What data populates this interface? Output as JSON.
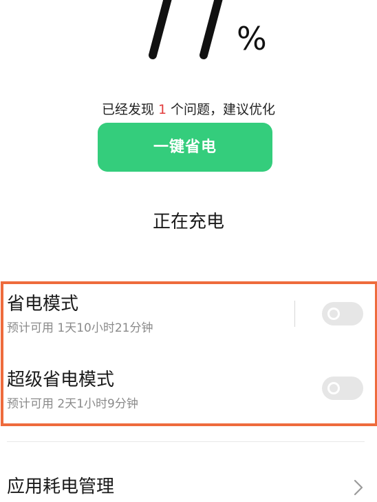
{
  "battery": {
    "percent_sign": "%"
  },
  "optimization": {
    "issue_prefix": "已经发现",
    "issue_count": "1",
    "issue_suffix": "个问题，建议优化",
    "button_label": "一键省电"
  },
  "charging": {
    "status": "正在充电"
  },
  "modes": [
    {
      "title": "省电模式",
      "estimate": "预计可用 1天10小时21分钟",
      "enabled": false
    },
    {
      "title": "超级省电模式",
      "estimate": "预计可用 2天1小时9分钟",
      "enabled": false
    }
  ],
  "app_usage": {
    "label": "应用耗电管理"
  },
  "colors": {
    "accent_green": "#34cd7c",
    "highlight_orange": "#ee6b3c",
    "issue_red": "#e23b3b"
  },
  "icons": {
    "app_usage_chevron": "chevron-right-icon"
  }
}
